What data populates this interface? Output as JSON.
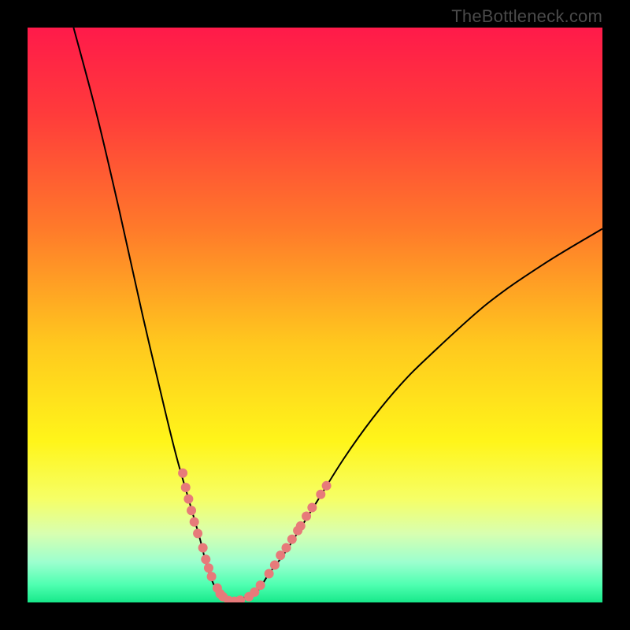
{
  "watermark": "TheBottleneck.com",
  "colors": {
    "bg_black": "#000000",
    "curve_stroke": "#000000",
    "dot_fill": "#e77a7a",
    "gradient_stops": [
      {
        "offset": 0.0,
        "color": "#ff1a4a"
      },
      {
        "offset": 0.15,
        "color": "#ff3b3b"
      },
      {
        "offset": 0.35,
        "color": "#ff7a2a"
      },
      {
        "offset": 0.55,
        "color": "#ffc81e"
      },
      {
        "offset": 0.72,
        "color": "#fff51a"
      },
      {
        "offset": 0.82,
        "color": "#f6ff66"
      },
      {
        "offset": 0.88,
        "color": "#d8ffb0"
      },
      {
        "offset": 0.93,
        "color": "#9cffcf"
      },
      {
        "offset": 0.97,
        "color": "#4dffb0"
      },
      {
        "offset": 1.0,
        "color": "#17e88a"
      }
    ]
  },
  "chart_data": {
    "type": "line",
    "title": "",
    "xlabel": "",
    "ylabel": "",
    "xlim": [
      0,
      100
    ],
    "ylim": [
      0,
      100
    ],
    "series": [
      {
        "name": "bottleneck-curve",
        "x": [
          8,
          12,
          16,
          20,
          24,
          26,
          28,
          30,
          31,
          32,
          33,
          34,
          35,
          36,
          38,
          40,
          42,
          45,
          50,
          55,
          60,
          65,
          70,
          80,
          90,
          100
        ],
        "y": [
          100,
          85,
          68,
          50,
          33,
          25,
          18,
          11,
          7,
          4,
          2,
          1,
          0,
          0,
          1,
          2,
          5,
          9,
          17,
          25,
          32,
          38,
          43,
          52,
          59,
          65
        ]
      }
    ],
    "dots": {
      "name": "highlight-dots",
      "points": [
        {
          "x": 27.0,
          "y": 22.5
        },
        {
          "x": 27.5,
          "y": 20.0
        },
        {
          "x": 28.0,
          "y": 18.0
        },
        {
          "x": 28.5,
          "y": 16.0
        },
        {
          "x": 29.0,
          "y": 14.0
        },
        {
          "x": 29.6,
          "y": 12.0
        },
        {
          "x": 30.5,
          "y": 9.5
        },
        {
          "x": 31.0,
          "y": 7.5
        },
        {
          "x": 31.5,
          "y": 6.0
        },
        {
          "x": 32.0,
          "y": 4.5
        },
        {
          "x": 33.0,
          "y": 2.5
        },
        {
          "x": 33.5,
          "y": 1.5
        },
        {
          "x": 34.0,
          "y": 1.0
        },
        {
          "x": 35.0,
          "y": 0.3
        },
        {
          "x": 36.0,
          "y": 0.2
        },
        {
          "x": 37.0,
          "y": 0.4
        },
        {
          "x": 38.5,
          "y": 1.0
        },
        {
          "x": 39.5,
          "y": 1.8
        },
        {
          "x": 40.5,
          "y": 3.0
        },
        {
          "x": 42.0,
          "y": 5.0
        },
        {
          "x": 43.0,
          "y": 6.5
        },
        {
          "x": 44.0,
          "y": 8.2
        },
        {
          "x": 45.0,
          "y": 9.5
        },
        {
          "x": 46.0,
          "y": 11.0
        },
        {
          "x": 47.0,
          "y": 12.5
        },
        {
          "x": 47.5,
          "y": 13.3
        },
        {
          "x": 48.5,
          "y": 15.0
        },
        {
          "x": 49.5,
          "y": 16.5
        },
        {
          "x": 51.0,
          "y": 18.8
        },
        {
          "x": 52.0,
          "y": 20.3
        }
      ],
      "radius": 6
    }
  }
}
